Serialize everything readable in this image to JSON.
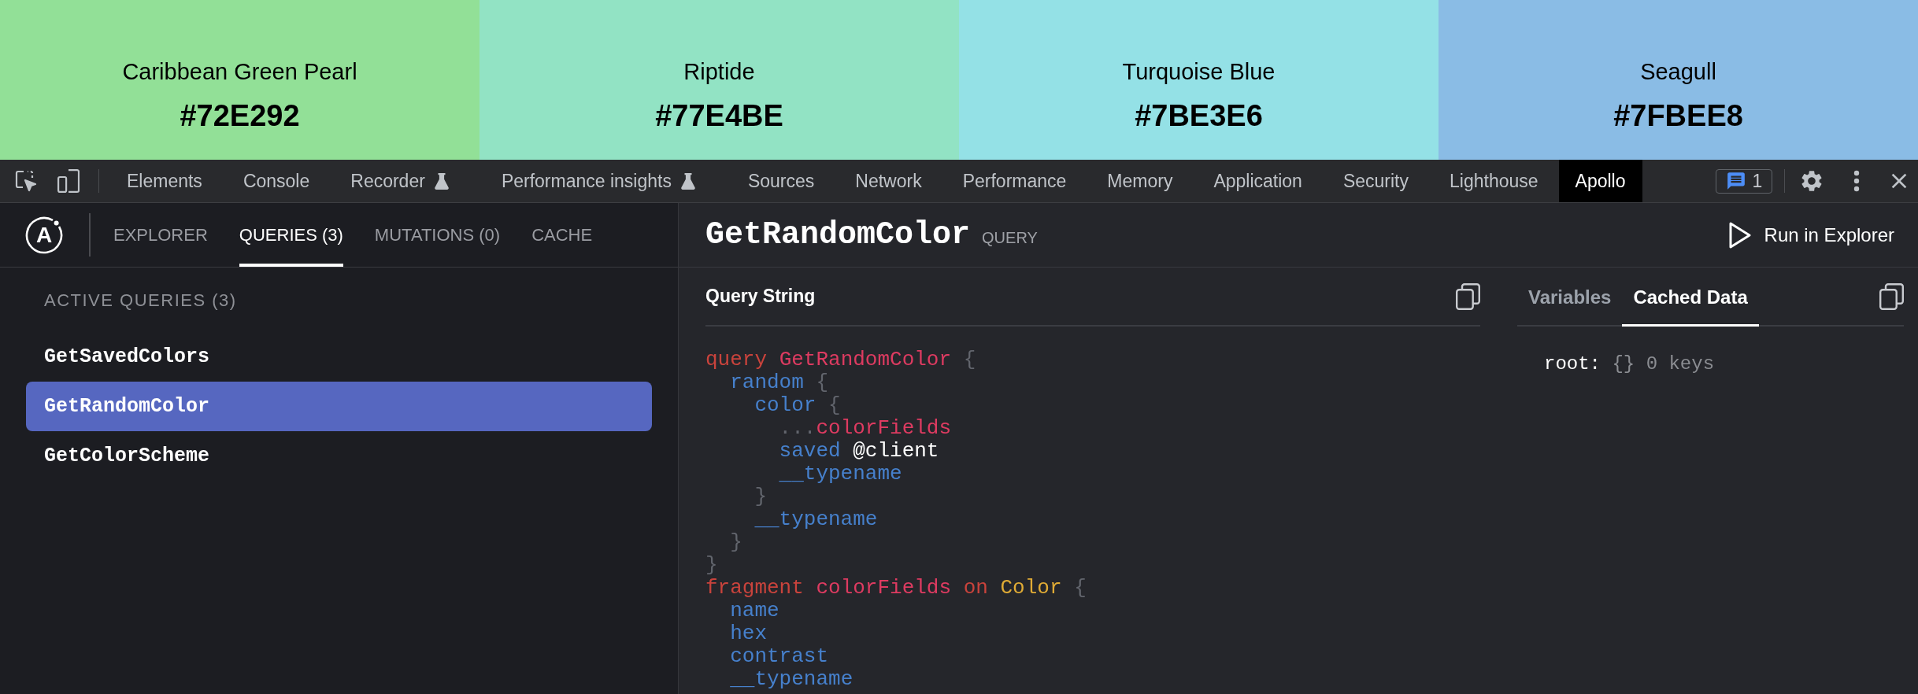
{
  "swatches": [
    {
      "name": "Caribbean Green Pearl",
      "hex": "#72E292",
      "color": "#92e097"
    },
    {
      "name": "Riptide",
      "hex": "#77E4BE",
      "color": "#92e3c4"
    },
    {
      "name": "Turquoise Blue",
      "hex": "#7BE3E6",
      "color": "#94e1e6"
    },
    {
      "name": "Seagull",
      "hex": "#7FBEE8",
      "color": "#8abce5"
    }
  ],
  "devtools": {
    "tabs": [
      {
        "label": "Elements",
        "selected": false,
        "experimental": false
      },
      {
        "label": "Console",
        "selected": false,
        "experimental": false
      },
      {
        "label": "Recorder",
        "selected": false,
        "experimental": true
      },
      {
        "label": "Performance insights",
        "selected": false,
        "experimental": true
      },
      {
        "label": "Sources",
        "selected": false,
        "experimental": false
      },
      {
        "label": "Network",
        "selected": false,
        "experimental": false
      },
      {
        "label": "Performance",
        "selected": false,
        "experimental": false
      },
      {
        "label": "Memory",
        "selected": false,
        "experimental": false
      },
      {
        "label": "Application",
        "selected": false,
        "experimental": false
      },
      {
        "label": "Security",
        "selected": false,
        "experimental": false
      },
      {
        "label": "Lighthouse",
        "selected": false,
        "experimental": false
      },
      {
        "label": "Apollo",
        "selected": true,
        "experimental": false
      }
    ],
    "issues_badge": "1"
  },
  "apollo": {
    "logo": "A",
    "nav": [
      {
        "label": "EXPLORER",
        "selected": false
      },
      {
        "label": "QUERIES (3)",
        "selected": true
      },
      {
        "label": "MUTATIONS (0)",
        "selected": false
      },
      {
        "label": "CACHE",
        "selected": false
      }
    ],
    "sidebar": {
      "heading": "ACTIVE QUERIES (3)",
      "items": [
        {
          "label": "GetSavedColors",
          "selected": false
        },
        {
          "label": "GetRandomColor",
          "selected": true
        },
        {
          "label": "GetColorScheme",
          "selected": false
        }
      ]
    },
    "detail": {
      "title": "GetRandomColor",
      "type": "QUERY",
      "run_button": "Run in Explorer",
      "query_panel": {
        "title": "Query String",
        "code": [
          {
            "tokens": [
              {
                "text": "query",
                "kind": "keyword"
              },
              {
                "text": "GetRandomColor",
                "kind": "name"
              },
              {
                "text": "{",
                "kind": "punct"
              }
            ],
            "children": [
              {
                "tokens": [
                  {
                    "text": "random",
                    "kind": "field"
                  },
                  {
                    "text": "{",
                    "kind": "punct"
                  }
                ],
                "children": [
                  {
                    "tokens": [
                      {
                        "text": "color",
                        "kind": "field"
                      },
                      {
                        "text": "{",
                        "kind": "punct"
                      }
                    ],
                    "children": [
                      {
                        "tokens": [
                          {
                            "text": "...",
                            "kind": "spread"
                          },
                          {
                            "text": "colorFields",
                            "kind": "name"
                          }
                        ]
                      },
                      {
                        "tokens": [
                          {
                            "text": "saved",
                            "kind": "field"
                          },
                          {
                            "text": "@client",
                            "kind": "directive"
                          }
                        ]
                      },
                      {
                        "tokens": [
                          {
                            "text": "__typename",
                            "kind": "field"
                          }
                        ]
                      }
                    ]
                  },
                  {
                    "tokens": [
                      {
                        "text": "}",
                        "kind": "punct"
                      }
                    ]
                  },
                  {
                    "tokens": [
                      {
                        "text": "__typename",
                        "kind": "field"
                      }
                    ]
                  }
                ]
              },
              {
                "tokens": [
                  {
                    "text": "}",
                    "kind": "punct"
                  }
                ]
              }
            ]
          },
          {
            "tokens": [
              {
                "text": "}",
                "kind": "punct"
              }
            ]
          },
          {
            "tokens": [
              {
                "text": "fragment",
                "kind": "keyword"
              },
              {
                "text": "colorFields",
                "kind": "name"
              },
              {
                "text": "on",
                "kind": "keyword"
              },
              {
                "text": "Color",
                "kind": "type"
              },
              {
                "text": "{",
                "kind": "punct"
              }
            ],
            "children": [
              {
                "tokens": [
                  {
                    "text": "name",
                    "kind": "field"
                  }
                ]
              },
              {
                "tokens": [
                  {
                    "text": "hex",
                    "kind": "field"
                  }
                ]
              },
              {
                "tokens": [
                  {
                    "text": "contrast",
                    "kind": "field"
                  }
                ]
              },
              {
                "tokens": [
                  {
                    "text": "__typename",
                    "kind": "field"
                  }
                ]
              }
            ]
          }
        ]
      },
      "data_panel": {
        "tabs": [
          {
            "label": "Variables",
            "selected": false
          },
          {
            "label": "Cached Data",
            "selected": true
          }
        ],
        "entry": {
          "key": "root:",
          "value": "{}",
          "count": "0 keys"
        }
      }
    }
  }
}
